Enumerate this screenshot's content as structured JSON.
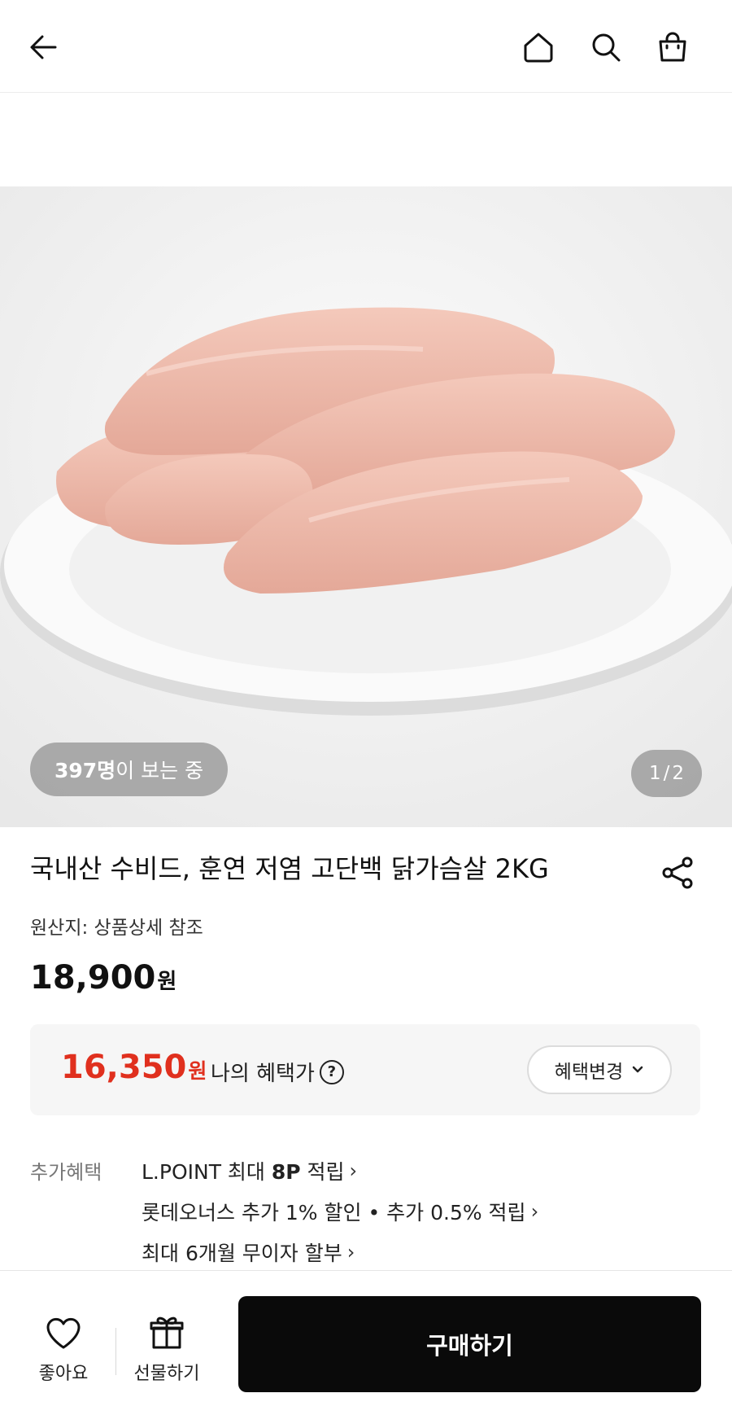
{
  "header": {
    "icons": [
      "back-arrow-icon",
      "home-icon",
      "search-icon",
      "shopping-bag-icon"
    ]
  },
  "gallery": {
    "viewers_count": "397명",
    "viewers_suffix": "이 보는 중",
    "pager_current": "1",
    "pager_sep": "/",
    "pager_total": "2"
  },
  "product": {
    "title": "국내산 수비드, 훈연 저염 고단백 닭가슴살 2KG",
    "origin": "원산지: 상품상세 참조",
    "price": "18,900",
    "price_unit": "원"
  },
  "benefit": {
    "price": "16,350",
    "price_unit": "원",
    "label": "나의 혜택가",
    "help": "?",
    "change_label": "혜택변경"
  },
  "extra": {
    "label": "추가혜택",
    "items": [
      {
        "pre": "L.POINT 최대 ",
        "bold": "8P",
        "post": " 적립"
      },
      {
        "text": "롯데오너스 추가 1% 할인 • 추가 0.5% 적립"
      },
      {
        "text": "최대 6개월 무이자 할부"
      }
    ]
  },
  "bottom_bar": {
    "like_label": "좋아요",
    "gift_label": "선물하기",
    "buy_label": "구매하기"
  },
  "colors": {
    "benefit_price": "#e0301e",
    "buy_button": "#0a0a0a"
  }
}
